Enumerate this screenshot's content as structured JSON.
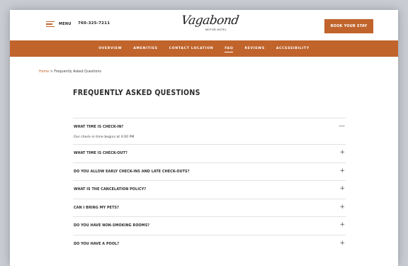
{
  "header": {
    "menu_label": "MENU",
    "phone": "760-325-7211",
    "logo_script": "Vagabond",
    "logo_subtitle": "MOTOR HOTEL",
    "book_label": "BOOK YOUR STAY"
  },
  "nav": {
    "items": [
      "OVERVIEW",
      "AMENITIES",
      "CONTACT LOCATION",
      "FAQ",
      "REVIEWS",
      "ACCESSIBILITY"
    ],
    "active": "FAQ"
  },
  "breadcrumb": {
    "home": "Home",
    "separator": ">",
    "current": "Frequently Asked Questions"
  },
  "page": {
    "title": "FREQUENTLY ASKED QUESTIONS"
  },
  "faq": [
    {
      "question": "WHAT TIME IS CHECK-IN?",
      "answer": "Our check-in time begins at 4:00 PM",
      "toggle": "—"
    },
    {
      "question": "WHAT TIME IS CHECK-OUT?",
      "toggle": "+"
    },
    {
      "question": "DO YOU ALLOW EARLY CHECK-INS AND LATE CHECK-OUTS?",
      "toggle": "+"
    },
    {
      "question": "WHAT IS THE CANCELATION POLICY?",
      "toggle": "+"
    },
    {
      "question": "CAN I BRING MY PETS?",
      "toggle": "+"
    },
    {
      "question": "DO YOU HAVE NON-SMOKING ROOMS?",
      "toggle": "+"
    },
    {
      "question": "DO YOU HAVE A POOL?",
      "toggle": "+"
    }
  ],
  "colors": {
    "accent": "#c0642c",
    "text": "#2a2a2a",
    "background": "#ffffff"
  },
  "icons": {
    "menu": "hamburger-icon",
    "expanded": "minus-icon",
    "collapsed": "plus-icon"
  }
}
